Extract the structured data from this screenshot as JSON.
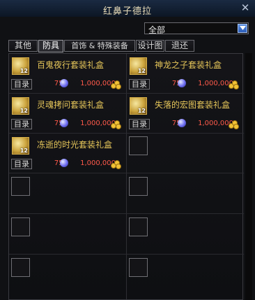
{
  "window": {
    "title": "红鼻子德拉"
  },
  "filter": {
    "selected": "全部"
  },
  "tabs": [
    {
      "label": "其他"
    },
    {
      "label": "防具"
    },
    {
      "label": "首饰 & 特殊装备"
    },
    {
      "label": "设计图"
    },
    {
      "label": "退还"
    }
  ],
  "items": [
    {
      "name": "百鬼夜行套装礼盒",
      "level": "12",
      "catalog": "目录",
      "price": "750",
      "gold": "1,000,000"
    },
    {
      "name": "神龙之子套装礼盒",
      "level": "12",
      "catalog": "目录",
      "price": "750",
      "gold": "1,000,000"
    },
    {
      "name": "灵魂拷问套装礼盒",
      "level": "12",
      "catalog": "目录",
      "price": "750",
      "gold": "1,000,000"
    },
    {
      "name": "失落的宏图套装礼盒",
      "level": "12",
      "catalog": "目录",
      "price": "750",
      "gold": "1,000,000"
    },
    {
      "name": "冻逝的时光套装礼盒",
      "level": "12",
      "catalog": "目录",
      "price": "750",
      "gold": "1,000,000"
    }
  ],
  "colors": {
    "item_name": "#e7c75a",
    "price_red": "#ff5a4a",
    "title_bar": "#1a2a42"
  }
}
